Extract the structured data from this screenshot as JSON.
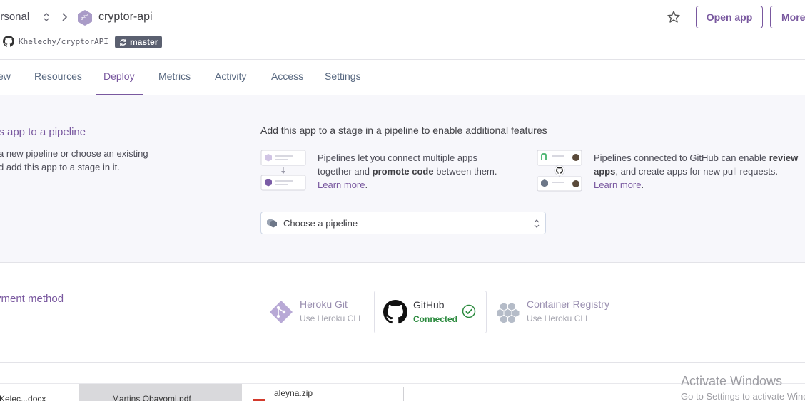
{
  "header": {
    "team": "ersonal",
    "app_name": "cryptor-api",
    "repo": "Khelechy/cryptorAPI",
    "branch": "master",
    "open_app_label": "Open app",
    "more_label": "More"
  },
  "tabs": [
    {
      "label": "ew"
    },
    {
      "label": "Resources"
    },
    {
      "label": "Deploy"
    },
    {
      "label": "Metrics"
    },
    {
      "label": "Activity"
    },
    {
      "label": "Access"
    },
    {
      "label": "Settings"
    }
  ],
  "active_tab": "Deploy",
  "pipeline": {
    "title": "is app to a pipeline",
    "desc_line1": "a new pipeline or choose an existing",
    "desc_line2": "d add this app to a stage in it.",
    "heading": "Add this app to a stage in a pipeline to enable additional features",
    "feature1": {
      "t1": "Pipelines let you connect multiple apps",
      "t2a": "together and ",
      "t2b": "promote code",
      "t2c": " between them.",
      "link": "Learn more",
      "dot": "."
    },
    "feature2": {
      "t1a": "Pipelines connected to GitHub can enable ",
      "t1b": "review",
      "t2a": "apps",
      "t2b": ", and create apps for new pull requests.",
      "link": "Learn more",
      "dot": "."
    },
    "select_label": "Choose a pipeline"
  },
  "deployment": {
    "title": "yment method",
    "methods": [
      {
        "name": "Heroku Git",
        "sub": "Use Heroku CLI"
      },
      {
        "name": "GitHub",
        "sub": "Connected"
      },
      {
        "name": "Container Registry",
        "sub": "Use Heroku CLI"
      }
    ]
  },
  "downloads": [
    {
      "name": "Kelec...docx"
    },
    {
      "name": "Martins Obayomi.pdf"
    },
    {
      "name": "aleyna.zip"
    }
  ],
  "watermark": {
    "line1": "Activate Windows",
    "line2": "Go to Settings to activate Windows."
  },
  "colors": {
    "accent": "#79589f",
    "success": "#2b8a3e",
    "section_bg": "#f7f7fb"
  }
}
